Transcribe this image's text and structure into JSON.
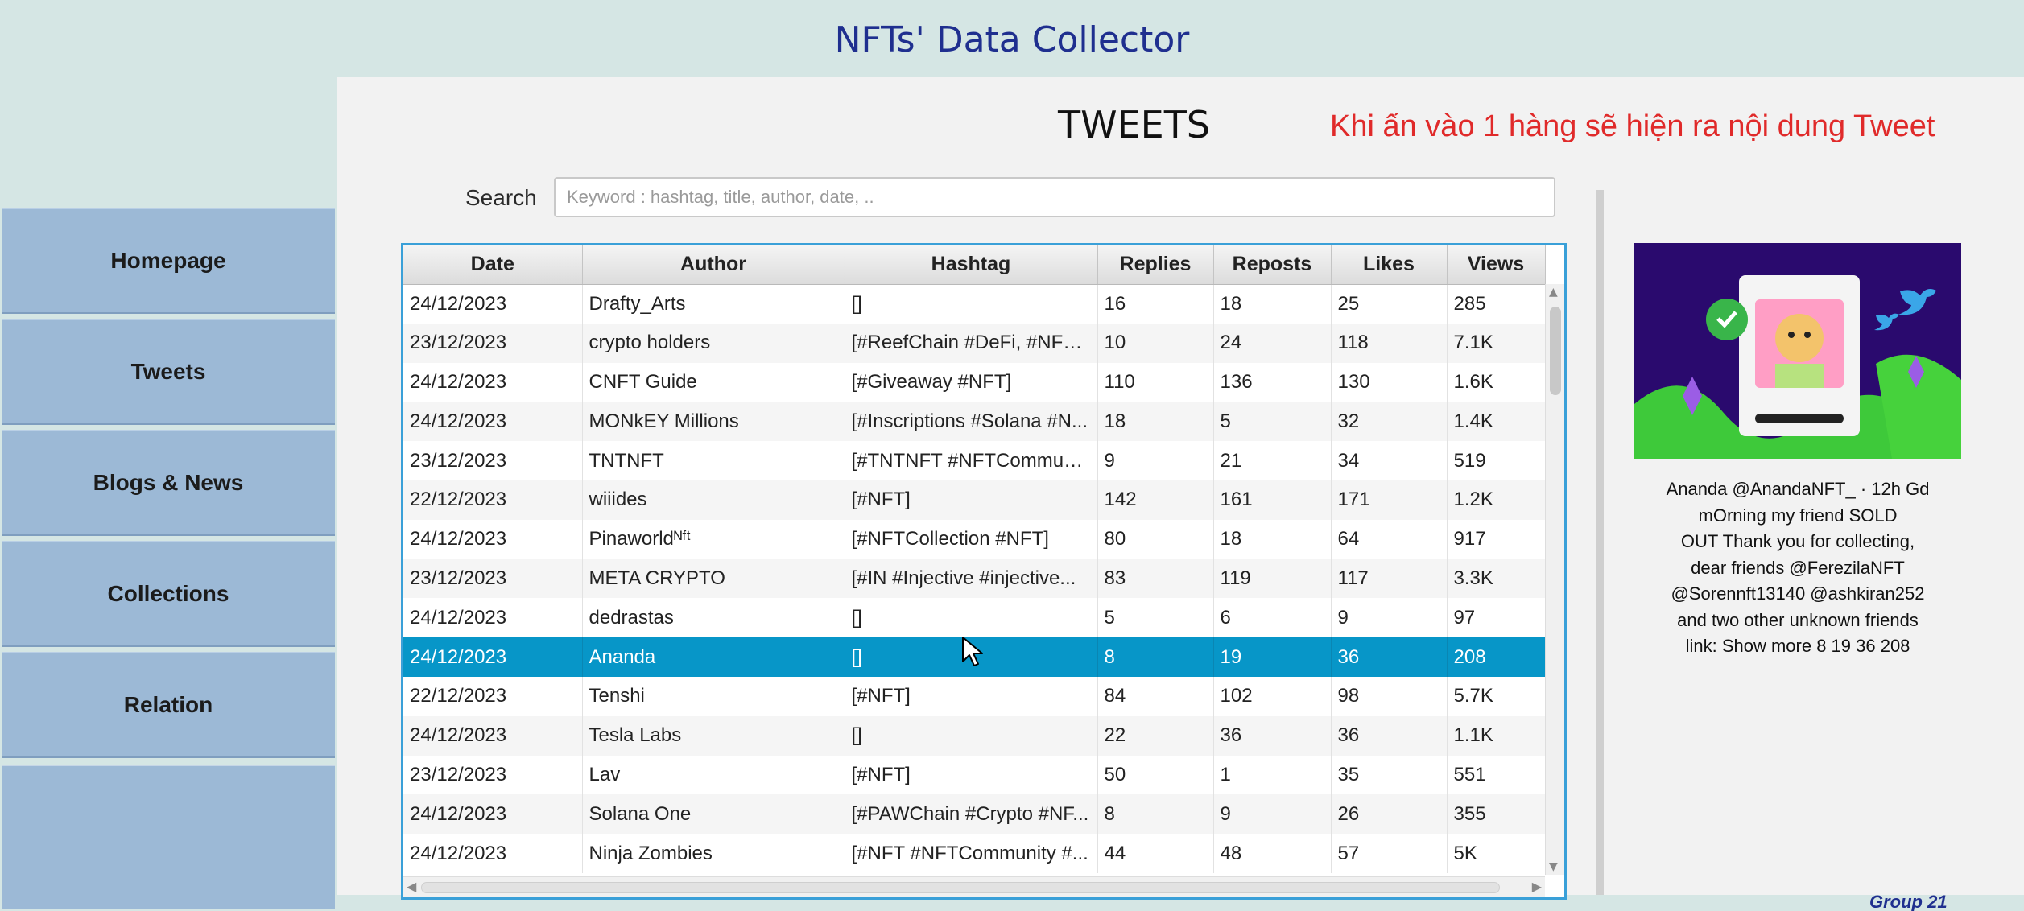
{
  "app": {
    "title": "NFTs' Data Collector"
  },
  "sidebar": {
    "items": [
      {
        "label": "Homepage"
      },
      {
        "label": "Tweets"
      },
      {
        "label": "Blogs & News"
      },
      {
        "label": "Collections"
      },
      {
        "label": "Relation"
      }
    ]
  },
  "page": {
    "heading": "TWEETS",
    "annotation": "Khi ấn vào 1 hàng sẽ hiện ra nội dung Tweet"
  },
  "search": {
    "label": "Search",
    "value": "",
    "placeholder": "Keyword : hashtag, title, author, date, .."
  },
  "table": {
    "columns": [
      "Date",
      "Author",
      "Hashtag",
      "Replies",
      "Reposts",
      "Likes",
      "Views"
    ],
    "selected_row_index": 9,
    "rows": [
      [
        "24/12/2023",
        "Drafty_Arts",
        "[]",
        "16",
        "18",
        "25",
        "285"
      ],
      [
        "23/12/2023",
        "crypto holders",
        "[#ReefChain #DeFi, #NFT ...",
        "10",
        "24",
        "118",
        "7.1K"
      ],
      [
        "24/12/2023",
        "CNFT Guide",
        "[#Giveaway #NFT]",
        "110",
        "136",
        "130",
        "1.6K"
      ],
      [
        "24/12/2023",
        "MONkEY Millions",
        "[#Inscriptions #Solana #N...",
        "18",
        "5",
        "32",
        "1.4K"
      ],
      [
        "23/12/2023",
        "TNTNFT",
        "[#TNTNFT #NFTCommuni...",
        "9",
        "21",
        "34",
        "519"
      ],
      [
        "22/12/2023",
        "wiiides",
        "[#NFT]",
        "142",
        "161",
        "171",
        "1.2K"
      ],
      [
        "24/12/2023",
        "Pinaworldᴺᶠᵗ",
        "[#NFTCollection #NFT]",
        "80",
        "18",
        "64",
        "917"
      ],
      [
        "23/12/2023",
        "META CRYPTO",
        "[#IN #Injective #injective...",
        "83",
        "119",
        "117",
        "3.3K"
      ],
      [
        "24/12/2023",
        "dedrastas",
        "[]",
        "5",
        "6",
        "9",
        "97"
      ],
      [
        "24/12/2023",
        "Ananda",
        "[]",
        "8",
        "19",
        "36",
        "208"
      ],
      [
        "22/12/2023",
        "Tenshi",
        "[#NFT]",
        "84",
        "102",
        "98",
        "5.7K"
      ],
      [
        "24/12/2023",
        "Tesla Labs",
        "[]",
        "22",
        "36",
        "36",
        "1.1K"
      ],
      [
        "23/12/2023",
        "Lav",
        "[#NFT]",
        "50",
        "1",
        "35",
        "551"
      ],
      [
        "24/12/2023",
        "Solana One",
        "[#PAWChain #Crypto #NF...",
        "8",
        "9",
        "26",
        "355"
      ],
      [
        "24/12/2023",
        "Ninja Zombies",
        "[#NFT #NFTCommunity #...",
        "44",
        "48",
        "57",
        "5K"
      ]
    ]
  },
  "detail": {
    "image_alt": "nft-tweet-image",
    "lines": [
      "Ananda @AnandaNFT_ · 12h Gd",
      "mOrning my friend  SOLD",
      "OUT   Thank you for collecting,",
      "dear friends @FerezilaNFT",
      "@Sorennft13140 @ashkiran252",
      "and two other unknown friends",
      "link:  Show more 8 19 36 208"
    ]
  },
  "footer": {
    "text": "Group 21"
  },
  "colors": {
    "background": "#d5e6e4",
    "sidebar": "#9cb9d6",
    "title": "#1f2f8f",
    "annotation": "#e02a2a",
    "selected_row": "#0796c8",
    "table_border": "#3aa0d8"
  }
}
